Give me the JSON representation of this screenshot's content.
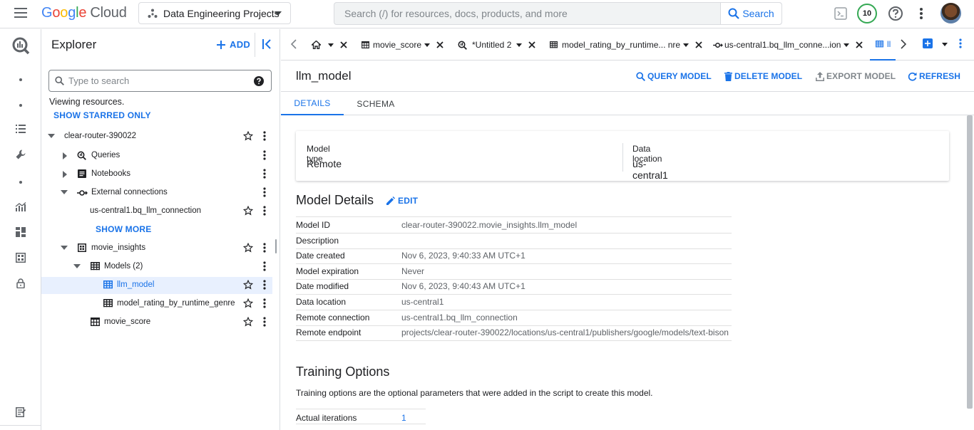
{
  "topbar": {
    "logo_brand": [
      "G",
      "o",
      "o",
      "g",
      "l",
      "e"
    ],
    "logo_product": "Cloud",
    "project_name": "Data Engineering Projects",
    "search_placeholder": "Search (/) for resources, docs, products, and more",
    "search_button": "Search",
    "notification_count": "10"
  },
  "explorer": {
    "title": "Explorer",
    "add_label": "ADD",
    "search_placeholder": "Type to search",
    "viewing_text": "Viewing resources.",
    "show_starred": "SHOW STARRED ONLY",
    "show_more": "SHOW MORE",
    "tree": [
      {
        "label": "clear-router-390022",
        "icon": "none",
        "expanded": true
      },
      {
        "label": "Queries",
        "icon": "queries-icon",
        "expanded": false
      },
      {
        "label": "Notebooks",
        "icon": "notebook-icon",
        "expanded": false
      },
      {
        "label": "External connections",
        "icon": "connection-icon",
        "expanded": true
      },
      {
        "label": "us-central1.bq_llm_connection",
        "icon": "none"
      },
      {
        "label": "movie_insights",
        "icon": "dataset-icon",
        "expanded": true
      },
      {
        "label": "Models (2)",
        "icon": "model-icon",
        "expanded": true
      },
      {
        "label": "llm_model",
        "icon": "model-icon",
        "selected": true
      },
      {
        "label": "model_rating_by_runtime_genre",
        "icon": "model-icon"
      },
      {
        "label": "movie_score",
        "icon": "table-icon"
      }
    ]
  },
  "tabs": [
    {
      "label": "",
      "icon": "home-icon"
    },
    {
      "label": "movie_score",
      "icon": "table-icon"
    },
    {
      "label": "*Untitled 2",
      "icon": "query-icon"
    },
    {
      "label": "model_rating_by_runtime... nre",
      "icon": "model-icon"
    },
    {
      "label": "us-central1.bq_llm_conne...ion",
      "icon": "connection-icon"
    },
    {
      "label": "ll",
      "icon": "model-icon",
      "active": true
    }
  ],
  "resource": {
    "title": "llm_model",
    "actions": {
      "query_model": "QUERY MODEL",
      "delete_model": "DELETE MODEL",
      "export_model": "EXPORT MODEL",
      "refresh": "REFRESH"
    },
    "subtabs": {
      "details": "DETAILS",
      "schema": "SCHEMA"
    }
  },
  "info_card": {
    "model_type_label": "Model type",
    "model_type_value": "Remote",
    "data_location_label": "Data location",
    "data_location_value": "us-central1"
  },
  "model_details": {
    "title": "Model Details",
    "edit_label": "EDIT",
    "rows": [
      {
        "key": "Model ID",
        "value": "clear-router-390022.movie_insights.llm_model"
      },
      {
        "key": "Description",
        "value": ""
      },
      {
        "key": "Date created",
        "value": "Nov 6, 2023, 9:40:33 AM UTC+1"
      },
      {
        "key": "Model expiration",
        "value": "Never"
      },
      {
        "key": "Date modified",
        "value": "Nov 6, 2023, 9:40:43 AM UTC+1"
      },
      {
        "key": "Data location",
        "value": "us-central1"
      },
      {
        "key": "Remote connection",
        "value": "us-central1.bq_llm_connection"
      },
      {
        "key": "Remote endpoint",
        "value": "projects/clear-router-390022/locations/us-central1/publishers/google/models/text-bison"
      }
    ]
  },
  "training_options": {
    "title": "Training Options",
    "description": "Training options are the optional parameters that were added in the script to create this model.",
    "rows": [
      {
        "key": "Actual iterations",
        "value": "1"
      }
    ]
  },
  "colors": {
    "accent": "#1a73e8",
    "selected_bg": "#e8f0fe",
    "border": "#dadce0"
  }
}
